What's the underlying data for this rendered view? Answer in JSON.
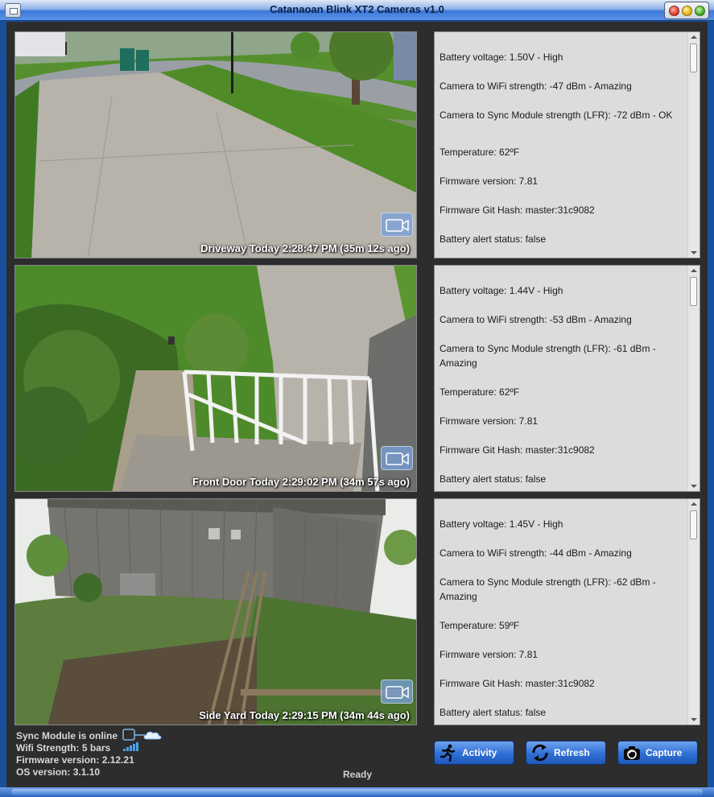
{
  "window": {
    "title": "Catanaoan Blink XT2 Cameras v1.0"
  },
  "cameras": [
    {
      "caption": "Driveway Today 2:28:47 PM (35m 12s ago)",
      "info": [
        "Battery voltage: 1.50V - High",
        "Camera to WiFi strength: -47 dBm - Amazing",
        "Camera to Sync Module strength (LFR): -72 dBm - OK",
        "Temperature: 62ºF",
        "Firmware version: 7.81",
        "Firmware Git Hash: master:31c9082",
        "Battery alert status: false"
      ]
    },
    {
      "caption": "Front Door Today 2:29:02 PM (34m 57s ago)",
      "info": [
        "Battery voltage: 1.44V - High",
        "Camera to WiFi strength: -53 dBm - Amazing",
        "Camera to Sync Module strength (LFR): -61 dBm - Amazing",
        "Temperature: 62ºF",
        "Firmware version: 7.81",
        "Firmware Git Hash: master:31c9082",
        "Battery alert status: false"
      ]
    },
    {
      "caption": "Side Yard Today 2:29:15 PM (34m 44s ago)",
      "info": [
        "Battery voltage: 1.45V - High",
        "Camera to WiFi strength: -44 dBm - Amazing",
        "Camera to Sync Module strength (LFR): -62 dBm - Amazing",
        "Temperature: 59ºF",
        "Firmware version: 7.81",
        "Firmware Git Hash: master:31c9082",
        "Battery alert status: false"
      ]
    }
  ],
  "status": {
    "sync_module": "Sync Module is online",
    "wifi_strength": "Wifi Strength: 5 bars",
    "wifi_bars": 5,
    "firmware": "Firmware version: 2.12.21",
    "os": "OS version: 3.1.10",
    "ready": "Ready"
  },
  "buttons": {
    "activity": "Activity",
    "refresh": "Refresh",
    "capture": "Capture"
  },
  "colors": {
    "title_bar": "#3c78d8",
    "button": "#2f6fd6",
    "panel_bg": "#dcdcdc",
    "client_bg": "#2d2d2d"
  }
}
